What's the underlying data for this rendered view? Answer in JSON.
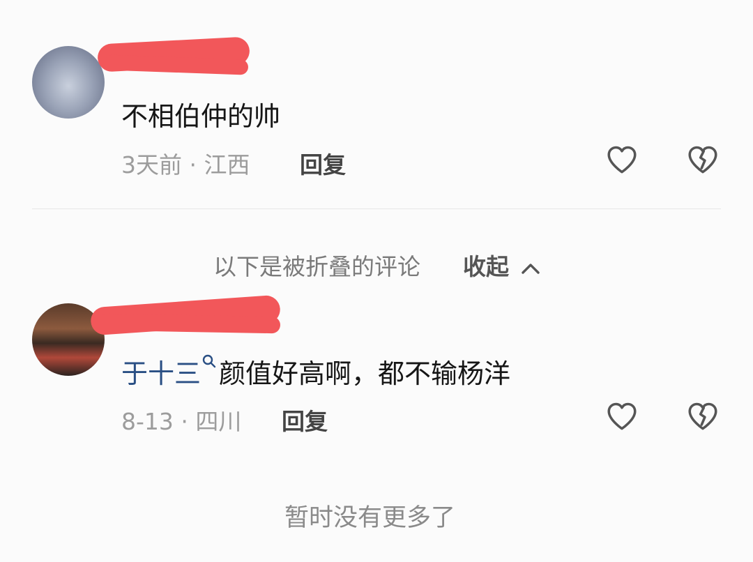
{
  "comments": [
    {
      "text": "不相伯仲的帅",
      "time": "3天前",
      "location": "江西",
      "reply_label": "回复"
    },
    {
      "mention": "于十三",
      "text": "颜值好高啊，都不输杨洋",
      "time": "8-13",
      "location": "四川",
      "reply_label": "回复"
    }
  ],
  "folded": {
    "label": "以下是被折叠的评论",
    "collapse_label": "收起"
  },
  "footer": {
    "end_text": "暂时没有更多了"
  },
  "colors": {
    "redaction": "#f2575a",
    "mention": "#2a4f84"
  },
  "icons": {
    "like": "heart-icon",
    "dislike": "broken-heart-icon",
    "mention_search": "search-icon",
    "collapse": "chevron-up-icon"
  }
}
